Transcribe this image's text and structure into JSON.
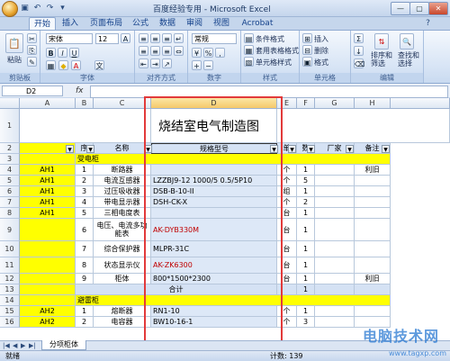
{
  "window": {
    "title": "百度经验专用 - Microsoft Excel",
    "min": "—",
    "max": "▢",
    "close": "✕"
  },
  "ribbon_tabs": [
    "开始",
    "插入",
    "页面布局",
    "公式",
    "数据",
    "审阅",
    "视图",
    "Acrobat"
  ],
  "ribbon": {
    "clipboard": {
      "label": "剪贴板",
      "paste": "粘贴"
    },
    "font": {
      "label": "字体",
      "name": "宋体",
      "size": "12",
      "bold": "B",
      "italic": "I",
      "underline": "U",
      "grow": "A",
      "shrink": "A"
    },
    "alignment": {
      "label": "对齐方式"
    },
    "number": {
      "label": "数字",
      "format": "常规",
      "percent": "%",
      "comma": ","
    },
    "styles": {
      "label": "样式",
      "cond": "条件格式",
      "table": "套用表格格式",
      "cell": "单元格样式"
    },
    "cells": {
      "label": "单元格",
      "insert": "插入",
      "delete": "删除",
      "format": "格式"
    },
    "editing": {
      "label": "编辑",
      "sort": "排序和筛选",
      "find": "查找和选择",
      "sigma": "Σ"
    }
  },
  "formula_bar": {
    "name_box": "D2",
    "fx": "fx"
  },
  "columns": [
    "A",
    "B",
    "C",
    "D",
    "E",
    "F",
    "G",
    "H"
  ],
  "rows": [
    {
      "n": "1",
      "title": "烧结室电气制造图"
    },
    {
      "n": "2",
      "headers": [
        "序",
        "名称",
        "规格型号",
        "单",
        "数",
        "厂家",
        "备注"
      ]
    },
    {
      "n": "3",
      "section": "受电柜"
    },
    {
      "n": "4",
      "a": "AH1",
      "b": "1",
      "c": "断路器",
      "d": "",
      "e": "个",
      "f": "1",
      "h": "利旧"
    },
    {
      "n": "5",
      "a": "AH1",
      "b": "2",
      "c": "电流互感器",
      "d": "LZZBJ9-12  1000/5  0.5/5P10",
      "e": "个",
      "f": "5",
      "h": ""
    },
    {
      "n": "6",
      "a": "AH1",
      "b": "3",
      "c": "过压吸收器",
      "d": "DSB-B-10-II",
      "e": "组",
      "f": "1",
      "h": ""
    },
    {
      "n": "7",
      "a": "AH1",
      "b": "4",
      "c": "带电显示器",
      "d": "DSH-CK-X",
      "e": "个",
      "f": "2",
      "h": ""
    },
    {
      "n": "8",
      "a": "AH1",
      "b": "5",
      "c": "三相电度表",
      "d": "",
      "e": "台",
      "f": "1",
      "h": ""
    },
    {
      "n": "9",
      "a": "",
      "b": "6",
      "c": "电压、电流多功能表",
      "d": "AK-DYB330M",
      "e": "台",
      "f": "1",
      "h": ""
    },
    {
      "n": "10",
      "a": "",
      "b": "7",
      "c": "综合保护器",
      "d": "MLPR-31C",
      "e": "台",
      "f": "1",
      "h": ""
    },
    {
      "n": "11",
      "a": "",
      "b": "8",
      "c": "状态显示仪",
      "d": "AK-ZK6300",
      "e": "台",
      "f": "1",
      "h": ""
    },
    {
      "n": "12",
      "a": "",
      "b": "9",
      "c": "柜体",
      "d": "800*1500*2300",
      "e": "台",
      "f": "1",
      "h": "利旧"
    },
    {
      "n": "13",
      "total": "合计",
      "f": "1"
    },
    {
      "n": "14",
      "section": "避雷柜"
    },
    {
      "n": "15",
      "a": "AH2",
      "b": "1",
      "c": "熔断器",
      "d": "RN1-10",
      "e": "个",
      "f": "1",
      "h": ""
    },
    {
      "n": "16",
      "a": "AH2",
      "b": "2",
      "c": "电容器",
      "d": "BW10-16-1",
      "e": "个",
      "f": "3",
      "h": ""
    }
  ],
  "sheet_tab": "分项柜体",
  "status": {
    "ready": "就绪",
    "count": "计数: 139"
  },
  "watermark": {
    "big": "电脑技术网",
    "small": "www.tagxp.com"
  },
  "colors": {
    "highlight_box": "#e23a3a",
    "yellow_fill": "#ffff00",
    "header_fill": "#d5e2f4"
  }
}
